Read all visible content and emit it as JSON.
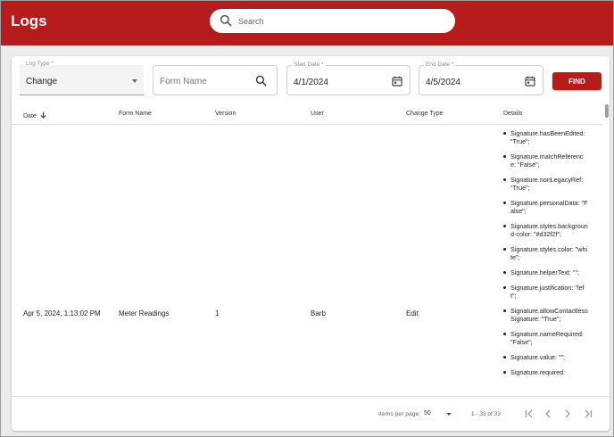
{
  "app": {
    "title": "Logs"
  },
  "search": {
    "placeholder": "Search"
  },
  "filters": {
    "log_type": {
      "label": "Log Type *",
      "value": "Change"
    },
    "form_name": {
      "placeholder": "Form Name"
    },
    "start_date": {
      "label": "Start Date *",
      "value": "4/1/2024"
    },
    "end_date": {
      "label": "End Date *",
      "value": "4/5/2024"
    },
    "find_label": "FIND"
  },
  "table": {
    "columns": [
      "Date",
      "Form Name",
      "Version",
      "User",
      "Change Type",
      "Details"
    ],
    "sort": {
      "column": "Date",
      "direction": "desc"
    },
    "rows": [
      {
        "date": "Apr 5, 2024, 1:13:02 PM",
        "form_name": "Meter Readings",
        "version": "1",
        "user": "Barb",
        "change_type": "Edit",
        "details": [
          "Signature.hasBeenEdited: \"True\";",
          "Signature.matchReference: \"False\";",
          "Signature.nonLegacyRef: \"True\";",
          "Signature.personalData: \"False\";",
          "Signature.styles.background-color: \"#d32f2f\";",
          "Signature.styles.color: \"white\";",
          "Signature.helperText: \"\";",
          "Signature.justification: \"left\";",
          "Signature.allowContactlessSignature: \"True\";",
          "Signature.nameRequired: \"False\";",
          "Signature.value: \"\";",
          "Signature.required:"
        ]
      }
    ]
  },
  "paginator": {
    "items_per_page_label": "Items per page:",
    "page_size": "50",
    "range": "1 - 33 of 33"
  },
  "colors": {
    "brand": "#b71c1c",
    "background": "#ececec",
    "card": "#ffffff"
  }
}
